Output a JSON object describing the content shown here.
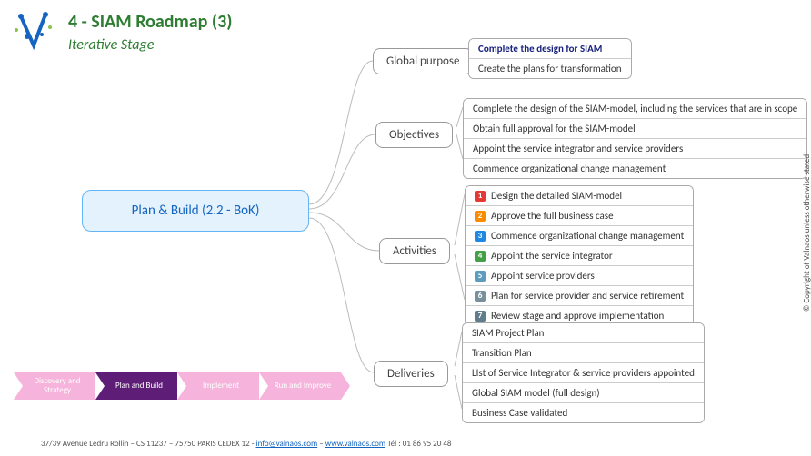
{
  "header": {
    "title": "4 - SIAM  Roadmap (3)",
    "subtitle": "Iterative Stage"
  },
  "root": "Plan & Build (2.2 - BoK)",
  "branches": {
    "b1": "Global purpose",
    "b2": "Objectives",
    "b3": "Activities",
    "b4": "Deliveries"
  },
  "globalPurpose": [
    {
      "text": "Complete the design for SIAM",
      "strong": true
    },
    {
      "text": "Create the plans for transformation"
    }
  ],
  "objectives": [
    {
      "text": "Complete the design of the SIAM-model, including the services that are in scope"
    },
    {
      "text": "Obtain full approval for the SIAM-model"
    },
    {
      "text": "Appoint the service integrator and service providers"
    },
    {
      "text": "Commence organizational change management"
    }
  ],
  "activities": [
    {
      "n": "1",
      "c": "#e53935",
      "text": "Design the detailed SIAM-model"
    },
    {
      "n": "2",
      "c": "#fb8c00",
      "text": "Approve the full business case"
    },
    {
      "n": "3",
      "c": "#1e88e5",
      "text": "Commence organizational change management"
    },
    {
      "n": "4",
      "c": "#43a047",
      "text": "Appoint the service integrator"
    },
    {
      "n": "5",
      "c": "#5e9cbf",
      "text": "Appoint service providers"
    },
    {
      "n": "6",
      "c": "#78909c",
      "text": "Plan for service provider and service retirement"
    },
    {
      "n": "7",
      "c": "#607d8b",
      "text": "Review stage and approve implementation"
    }
  ],
  "deliveries": [
    {
      "text": "SIAM Project Plan"
    },
    {
      "text": "Transition Plan"
    },
    {
      "text": "LIst of Service Integrator & service providers appointed"
    },
    {
      "text": "Global SIAM model  (full design)"
    },
    {
      "text": "Business Case validated"
    }
  ],
  "chevrons": [
    {
      "label": "Discovery and Strategy",
      "style": "light"
    },
    {
      "label": "Plan and Build",
      "style": "dark"
    },
    {
      "label": "Implement",
      "style": "light"
    },
    {
      "label": "Run and Improve",
      "style": "light"
    }
  ],
  "footer": {
    "address": "37/39 Avenue Ledru Rollin – CS 11237 – 75750 PARIS CEDEX 12  - ",
    "email": "info@valnaos.com",
    "sep": " – ",
    "web": "www.valnaos.com",
    "tel": "  Tél : 01 86 95 20 48"
  },
  "copyright": "© Copyright  of Valnaos unless otherwise stated"
}
